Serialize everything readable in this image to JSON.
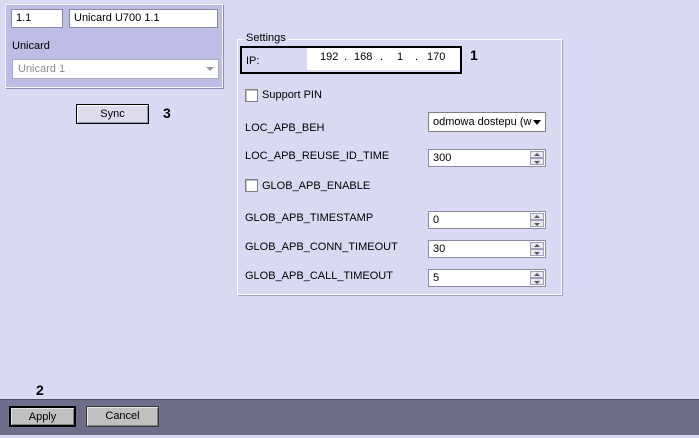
{
  "object_panel": {
    "id_value": "1.1",
    "name_value": "Unicard U700 1.1",
    "type_label": "Unicard",
    "type_select_value": "Unicard 1"
  },
  "sync_button": {
    "label": "Sync"
  },
  "settings": {
    "group_title": "Settings",
    "ip": {
      "label": "IP:",
      "octets": [
        "192",
        "168",
        "1",
        "170"
      ],
      "separator": "."
    },
    "support_pin": {
      "label": "Support PIN",
      "checked": false
    },
    "loc_apb_beh": {
      "label": "LOC_APB_BEH",
      "value": "odmowa dostepu (w"
    },
    "loc_apb_reuse_id_time": {
      "label": "LOC_APB_REUSE_ID_TIME",
      "value": "300"
    },
    "glob_apb_enable": {
      "label": "GLOB_APB_ENABLE",
      "checked": false
    },
    "glob_apb_timestamp": {
      "label": "GLOB_APB_TIMESTAMP",
      "value": "0"
    },
    "glob_apb_conn_timeout": {
      "label": "GLOB_APB_CONN_TIMEOUT",
      "value": "30"
    },
    "glob_apb_call_timeout": {
      "label": "GLOB_APB_CALL_TIMEOUT",
      "value": "5"
    }
  },
  "annotations": {
    "n1": "1",
    "n2": "2",
    "n3": "3"
  },
  "bottom_bar": {
    "apply_label": "Apply",
    "cancel_label": "Cancel"
  },
  "colors": {
    "background": "#d9d9f3",
    "panel": "#bdbde6",
    "bottom_bar": "#6e6e8a"
  }
}
